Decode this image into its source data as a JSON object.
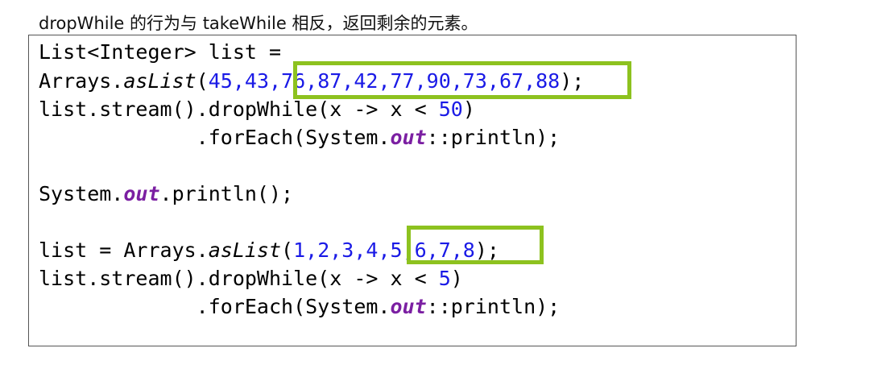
{
  "caption": {
    "text1": "dropWhile",
    "text2": " 的行为与 ",
    "text3": "takeWhile",
    "text4": " 相反，返回剩余的元素。"
  },
  "code": {
    "line1": "List<Integer> list =",
    "line2_a": "Arrays.",
    "line2_b": "asList",
    "line2_c": "(",
    "line2_d": "45,43,76,87,42,77,90,73,67,88",
    "line2_e": ");",
    "line3_a": "list.stream().dropWhile(x -> x < ",
    "line3_b": "50",
    "line3_c": ")",
    "line4_a": "             .forEach(System.",
    "line4_b": "out",
    "line4_c": "::println);",
    "line6_a": "System.",
    "line6_b": "out",
    "line6_c": ".println();",
    "line8_a": "list = Arrays.",
    "line8_b": "asList",
    "line8_c": "(",
    "line8_d": "1,2,3,4,5,6,7,8",
    "line8_e": ");",
    "line9_a": "list.stream().dropWhile(x -> x < ",
    "line9_b": "5",
    "line9_c": ")",
    "line10_a": "             .forEach(System.",
    "line10_b": "out",
    "line10_c": "::println);"
  },
  "colors": {
    "number": "#1a1ae6",
    "field": "#7b1fa2",
    "highlight": "#8dc21f"
  }
}
